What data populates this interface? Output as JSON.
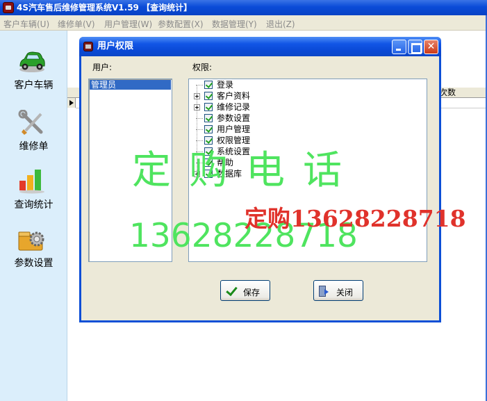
{
  "window": {
    "title": "4S汽车售后维修管理系统V1.59 【查询统计】"
  },
  "menu": [
    {
      "label": "客户车辆(U)"
    },
    {
      "label": "维修单(V)"
    },
    {
      "label": "用户管理(W)"
    },
    {
      "label": "参数配置(X)"
    },
    {
      "label": "数据管理(Y)"
    },
    {
      "label": "退出(Z)"
    }
  ],
  "sidebar": {
    "items": [
      {
        "label": "客户车辆",
        "icon": "car-icon"
      },
      {
        "label": "维修单",
        "icon": "tools-icon"
      },
      {
        "label": "查询统计",
        "icon": "bar-chart-icon"
      },
      {
        "label": "参数设置",
        "icon": "settings-gear-icon"
      }
    ]
  },
  "grid": {
    "visible_header": "次数"
  },
  "dialog": {
    "title": "用户权限",
    "users_label": "用户:",
    "users": [
      {
        "name": "管理员",
        "selected": true
      }
    ],
    "perm_label": "权限:",
    "permissions": [
      {
        "label": "登录",
        "expandable": false,
        "checked": true
      },
      {
        "label": "客户资料",
        "expandable": true,
        "checked": true
      },
      {
        "label": "维修记录",
        "expandable": true,
        "checked": true
      },
      {
        "label": "参数设置",
        "expandable": false,
        "checked": true
      },
      {
        "label": "用户管理",
        "expandable": false,
        "checked": true
      },
      {
        "label": "权限管理",
        "expandable": false,
        "checked": true
      },
      {
        "label": "系统设置",
        "expandable": false,
        "checked": true
      },
      {
        "label": "帮助",
        "expandable": false,
        "checked": true
      },
      {
        "label": "数据库",
        "expandable": true,
        "checked": true
      }
    ],
    "save_label": "保存",
    "close_label": "关闭"
  },
  "watermark": {
    "line1": "定购电话",
    "line2": "13628228718",
    "line3": "定购13628228718"
  },
  "colors": {
    "titlebar": "#0a4bd8",
    "selection": "#316ac5",
    "watermark_green": "#4fe45f",
    "watermark_red": "#e0322b"
  }
}
